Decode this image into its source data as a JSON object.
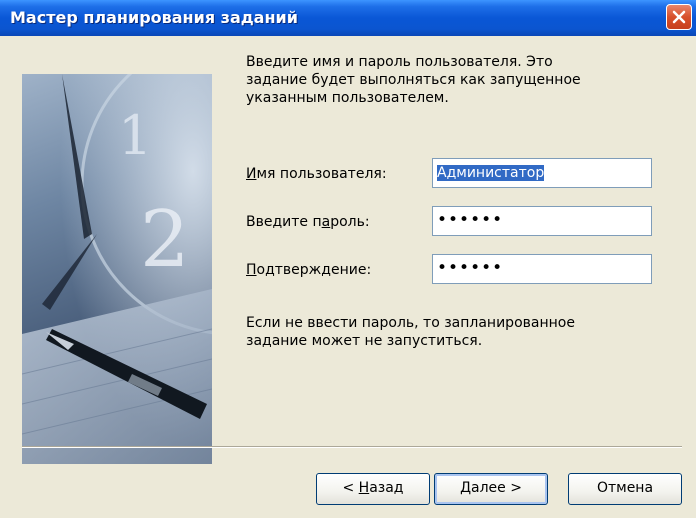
{
  "window": {
    "title": "Мастер планирования заданий"
  },
  "intro_text": [
    "Введите имя и пароль пользователя.  Это",
    "задание будет выполняться как запущенное",
    "указанным пользователем."
  ],
  "form": {
    "username": {
      "label_prefix": "",
      "label_accel": "И",
      "label_rest": "мя пользователя:",
      "value": "Администатор"
    },
    "password": {
      "label_prefix": "Введите п",
      "label_accel": "а",
      "label_rest": "роль:",
      "value": "••••••"
    },
    "confirm": {
      "label_prefix": "",
      "label_accel": "П",
      "label_rest": "одтверждение:",
      "value": "••••••"
    }
  },
  "note_text": [
    "Если не ввести пароль, то запланированное",
    "задание может не запуститься."
  ],
  "buttons": {
    "back": {
      "prefix": "< ",
      "accel": "Н",
      "rest": "азад"
    },
    "next": {
      "prefix": "",
      "accel": "Д",
      "rest": "алее >"
    },
    "cancel": {
      "label": "Отмена"
    }
  },
  "image_digits": [
    "1",
    "2"
  ],
  "colors": {
    "titlebar": "#0A57D6",
    "window_bg": "#ECE9D8",
    "selection": "#316AC5",
    "close_button": "#D8502B"
  }
}
